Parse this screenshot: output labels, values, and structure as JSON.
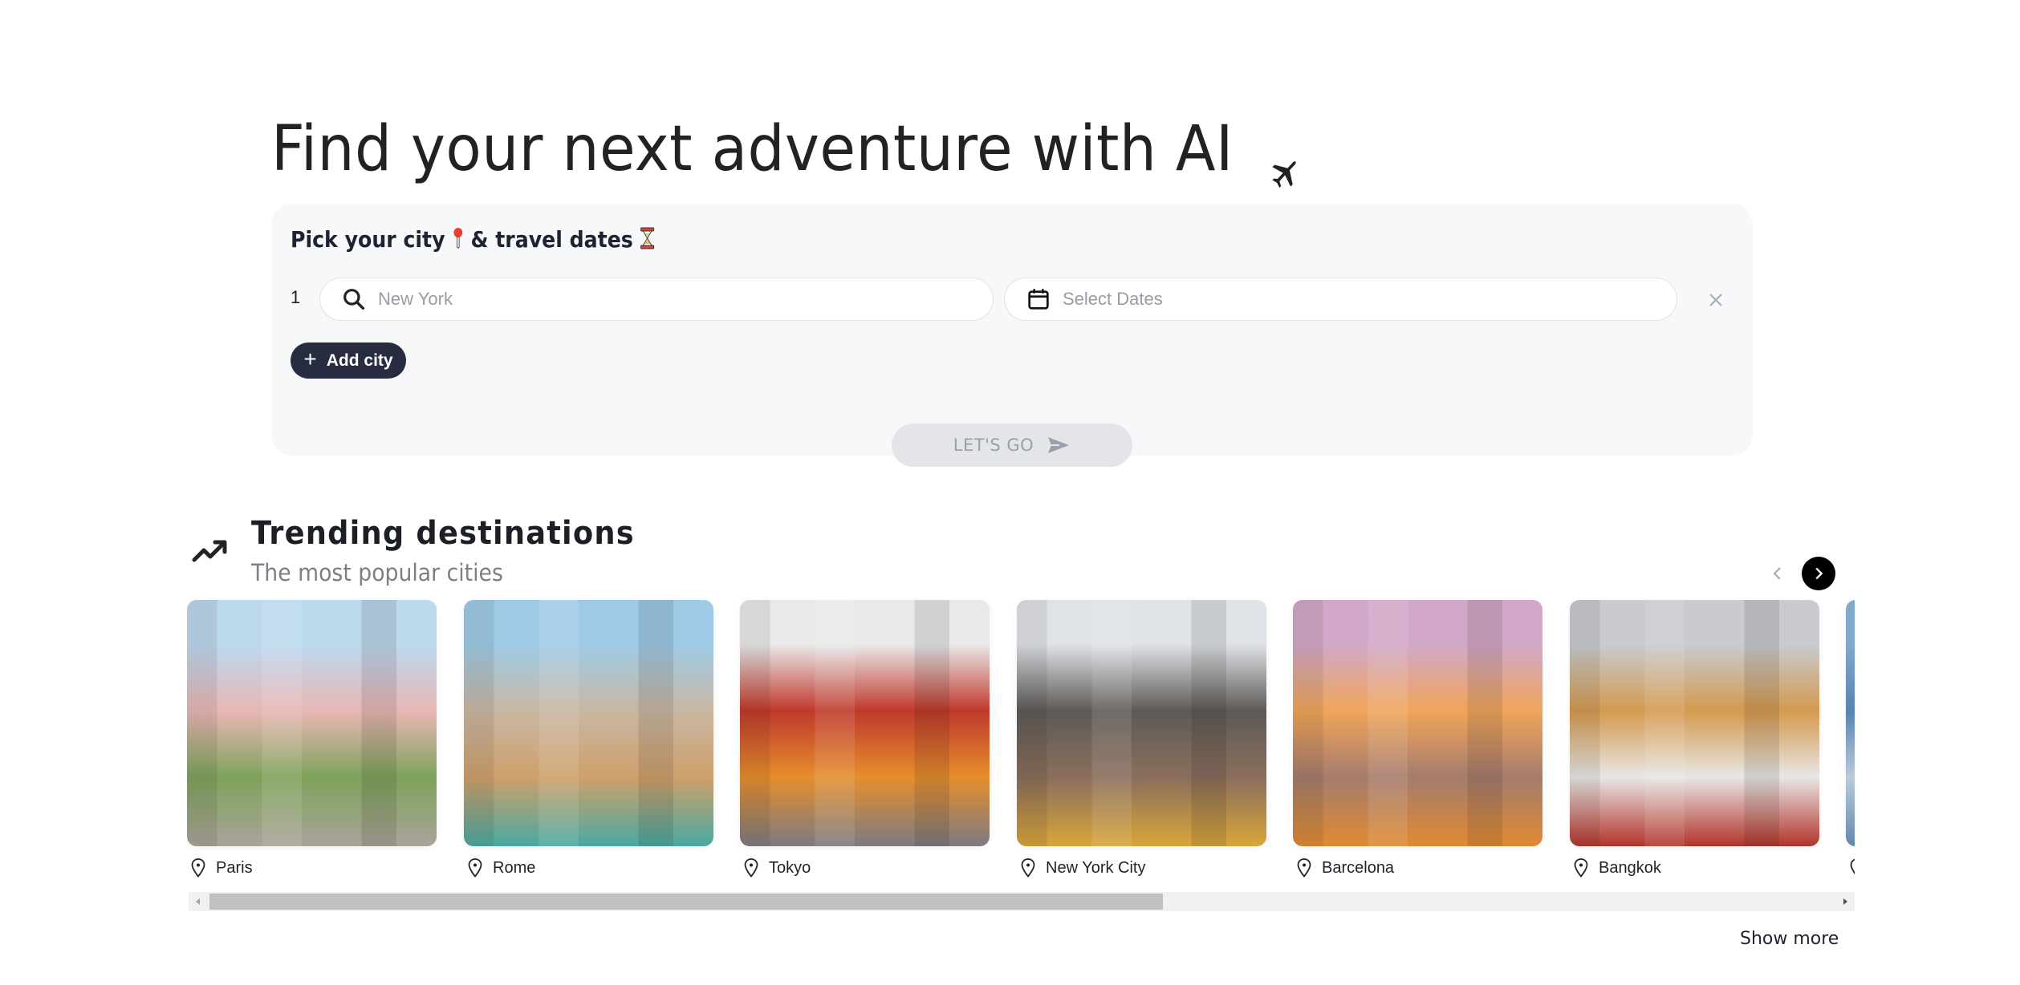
{
  "hero": {
    "title": "Find your next adventure with AI",
    "title_icon": "airplane-icon"
  },
  "planner": {
    "heading_part1": "Pick your city",
    "heading_icon1": "round-pushpin-emoji",
    "heading_part2": "& travel dates",
    "heading_icon2": "hourglass-emoji",
    "rows": [
      {
        "index": "1",
        "city_placeholder": "New York",
        "city_value": "",
        "dates_placeholder": "Select Dates"
      }
    ],
    "add_city_label": "Add city",
    "submit_label": "LET'S GO",
    "submit_enabled": false
  },
  "trending": {
    "title": "Trending destinations",
    "subtitle": "The most popular cities",
    "prev_enabled": false,
    "next_enabled": true,
    "cities": [
      {
        "name": "Paris",
        "palette": [
          "#bcd9ee",
          "#e8b7b5",
          "#7ea35a",
          "#a9a49a"
        ]
      },
      {
        "name": "Rome",
        "palette": [
          "#9fcbe6",
          "#c9b7a3",
          "#cfa06a",
          "#49a9a2"
        ]
      },
      {
        "name": "Tokyo",
        "palette": [
          "#e9e9ea",
          "#c0392b",
          "#e58e2e",
          "#7b7b80"
        ]
      },
      {
        "name": "New York City",
        "palette": [
          "#dfe2e6",
          "#5e5a57",
          "#8a6e5b",
          "#d9a53a"
        ]
      },
      {
        "name": "Barcelona",
        "palette": [
          "#d2a8c8",
          "#f0a55a",
          "#a57c6c",
          "#e08a32"
        ]
      },
      {
        "name": "Bangkok",
        "palette": [
          "#c9cbce",
          "#d49a4f",
          "#e8e6e4",
          "#b2342a"
        ]
      },
      {
        "name": "",
        "palette": [
          "#8db6dd",
          "#5f8fbf",
          "#c8dcec",
          "#6a93bb"
        ]
      }
    ],
    "scroll_progress": 0.0,
    "scroll_visible_fraction": 0.6,
    "show_more_label": "Show more"
  }
}
